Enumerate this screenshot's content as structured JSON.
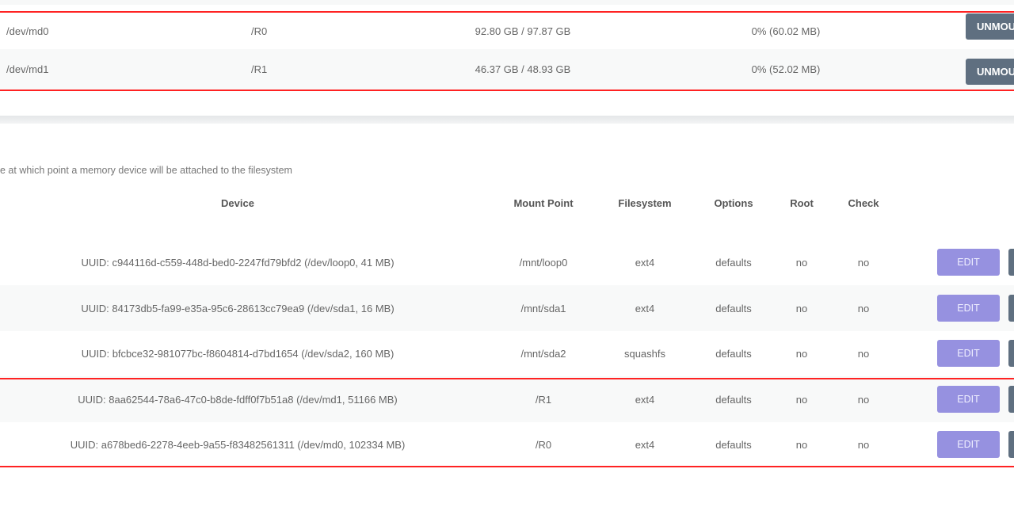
{
  "mounted": {
    "rows": [
      {
        "device": "/dev/md0",
        "mount": "/R0",
        "used": "92.80 GB / 97.87 GB",
        "usage": "0% (60.02 MB)",
        "action": "UNMOUNT"
      },
      {
        "device": "/dev/md1",
        "mount": "/R1",
        "used": "46.37 GB / 48.93 GB",
        "usage": "0% (52.02 MB)",
        "action": "UNMOUNT"
      }
    ]
  },
  "mount_points": {
    "description": "e at which point a memory device will be attached to the filesystem",
    "headers": {
      "device": "Device",
      "mount": "Mount Point",
      "fs": "Filesystem",
      "options": "Options",
      "root": "Root",
      "check": "Check"
    },
    "rows": [
      {
        "device": "UUID: c944116d-c559-448d-bed0-2247fd79bfd2 (/dev/loop0, 41 MB)",
        "mount": "/mnt/loop0",
        "fs": "ext4",
        "options": "defaults",
        "root": "no",
        "check": "no",
        "edit": "EDIT"
      },
      {
        "device": "UUID: 84173db5-fa99-e35a-95c6-28613cc79ea9 (/dev/sda1, 16 MB)",
        "mount": "/mnt/sda1",
        "fs": "ext4",
        "options": "defaults",
        "root": "no",
        "check": "no",
        "edit": "EDIT"
      },
      {
        "device": "UUID: bfcbce32-981077bc-f8604814-d7bd1654 (/dev/sda2, 160 MB)",
        "mount": "/mnt/sda2",
        "fs": "squashfs",
        "options": "defaults",
        "root": "no",
        "check": "no",
        "edit": "EDIT"
      },
      {
        "device": "UUID: 8aa62544-78a6-47c0-b8de-fdff0f7b51a8 (/dev/md1, 51166 MB)",
        "mount": "/R1",
        "fs": "ext4",
        "options": "defaults",
        "root": "no",
        "check": "no",
        "edit": "EDIT"
      },
      {
        "device": "UUID: a678bed6-2278-4eeb-9a55-f83482561311 (/dev/md0, 102334 MB)",
        "mount": "/R0",
        "fs": "ext4",
        "options": "defaults",
        "root": "no",
        "check": "no",
        "edit": "EDIT"
      }
    ]
  },
  "colors": {
    "highlight": "#ff2222",
    "edit_button": "#9691e0",
    "unmount_button": "#5f6f80"
  }
}
